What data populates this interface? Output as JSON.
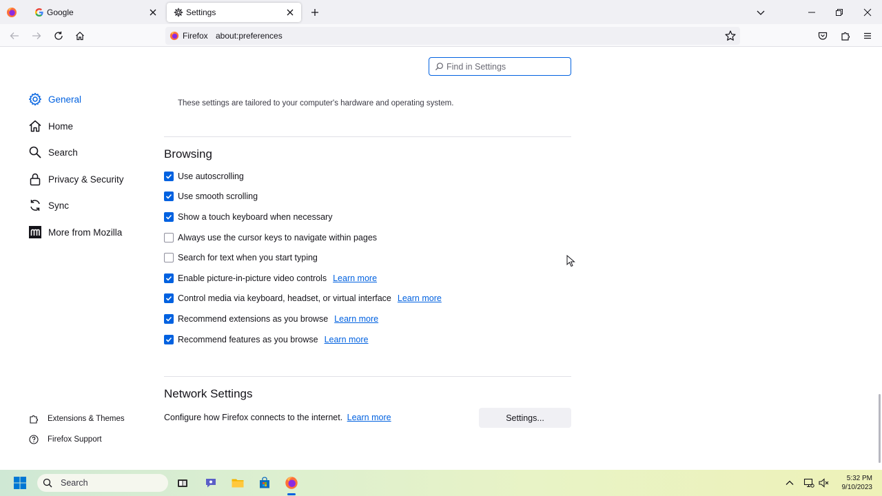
{
  "tabs": [
    {
      "title": "Google",
      "favicon": "google-icon",
      "active": false
    },
    {
      "title": "Settings",
      "favicon": "gear-icon",
      "active": true
    }
  ],
  "urlbar": {
    "identity_label": "Firefox",
    "url": "about:preferences"
  },
  "search": {
    "placeholder": "Find in Settings"
  },
  "sidebar": {
    "items": [
      {
        "label": "General",
        "icon": "gear-icon",
        "selected": true
      },
      {
        "label": "Home",
        "icon": "home-icon",
        "selected": false
      },
      {
        "label": "Search",
        "icon": "search-icon",
        "selected": false
      },
      {
        "label": "Privacy & Security",
        "icon": "lock-icon",
        "selected": false
      },
      {
        "label": "Sync",
        "icon": "sync-icon",
        "selected": false
      },
      {
        "label": "More from Mozilla",
        "icon": "mozilla-icon",
        "selected": false
      }
    ],
    "footer": [
      {
        "label": "Extensions & Themes",
        "icon": "puzzle-icon"
      },
      {
        "label": "Firefox Support",
        "icon": "help-icon"
      }
    ]
  },
  "main": {
    "tailored_text": "These settings are tailored to your computer's hardware and operating system.",
    "browsing": {
      "heading": "Browsing",
      "options": [
        {
          "label": "Use autoscrolling",
          "checked": true,
          "link": ""
        },
        {
          "label": "Use smooth scrolling",
          "checked": true,
          "link": ""
        },
        {
          "label": "Show a touch keyboard when necessary",
          "checked": true,
          "link": ""
        },
        {
          "label": "Always use the cursor keys to navigate within pages",
          "checked": false,
          "link": ""
        },
        {
          "label": "Search for text when you start typing",
          "checked": false,
          "link": ""
        },
        {
          "label": "Enable picture-in-picture video controls",
          "checked": true,
          "link": "Learn more"
        },
        {
          "label": "Control media via keyboard, headset, or virtual interface",
          "checked": true,
          "link": "Learn more"
        },
        {
          "label": "Recommend extensions as you browse",
          "checked": true,
          "link": "Learn more"
        },
        {
          "label": "Recommend features as you browse",
          "checked": true,
          "link": "Learn more"
        }
      ]
    },
    "network": {
      "heading": "Network Settings",
      "description": "Configure how Firefox connects to the internet.",
      "link": "Learn more",
      "button_label": "Settings..."
    }
  },
  "taskbar": {
    "search_label": "Search",
    "time": "5:32 PM",
    "date": "9/10/2023"
  },
  "colors": {
    "accent": "#0061e0",
    "tabstrip": "#f0f0f4",
    "text": "#15141a"
  }
}
